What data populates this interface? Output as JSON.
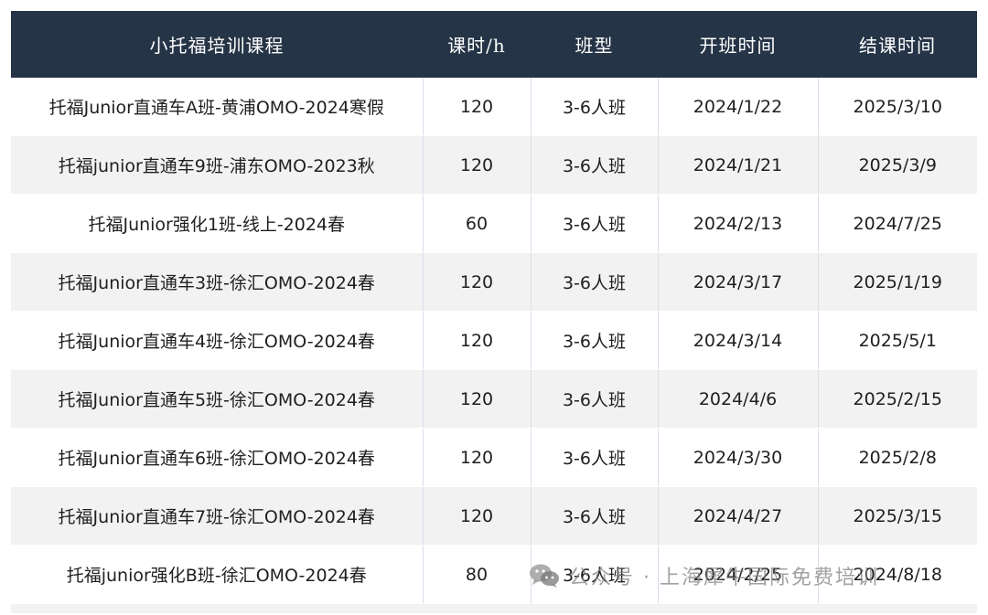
{
  "table": {
    "headers": [
      "小托福培训课程",
      "课时/h",
      "班型",
      "开班时间",
      "结课时间"
    ],
    "rows": [
      [
        "托福Junior直通车A班-黄浦OMO-2024寒假",
        "120",
        "3-6人班",
        "2024/1/22",
        "2025/3/10"
      ],
      [
        "托福junior直通车9班-浦东OMO-2023秋",
        "120",
        "3-6人班",
        "2024/1/21",
        "2025/3/9"
      ],
      [
        "托福Junior强化1班-线上-2024春",
        "60",
        "3-6人班",
        "2024/2/13",
        "2024/7/25"
      ],
      [
        "托福Junior直通车3班-徐汇OMO-2024春",
        "120",
        "3-6人班",
        "2024/3/17",
        "2025/1/19"
      ],
      [
        "托福Junior直通车4班-徐汇OMO-2024春",
        "120",
        "3-6人班",
        "2024/3/14",
        "2025/5/1"
      ],
      [
        "托福Junior直通车5班-徐汇OMO-2024春",
        "120",
        "3-6人班",
        "2024/4/6",
        "2025/2/15"
      ],
      [
        "托福Junior直通车6班-徐汇OMO-2024春",
        "120",
        "3-6人班",
        "2024/3/30",
        "2025/2/8"
      ],
      [
        "托福Junior直通车7班-徐汇OMO-2024春",
        "120",
        "3-6人班",
        "2024/4/27",
        "2025/3/15"
      ],
      [
        "托福junior强化B班-徐汇OMO-2024春",
        "80",
        "3-6人班",
        "2024/2/25",
        "2024/8/18"
      ]
    ]
  },
  "watermark": {
    "icon": "wechat-icon",
    "text": "公众号 · 上海犀牛国际免费培训"
  },
  "colors": {
    "header_bg": "#253446",
    "header_text": "#ffffff",
    "row_alt_bg": "#f2f2f2",
    "cell_divider": "#dcdcec"
  }
}
